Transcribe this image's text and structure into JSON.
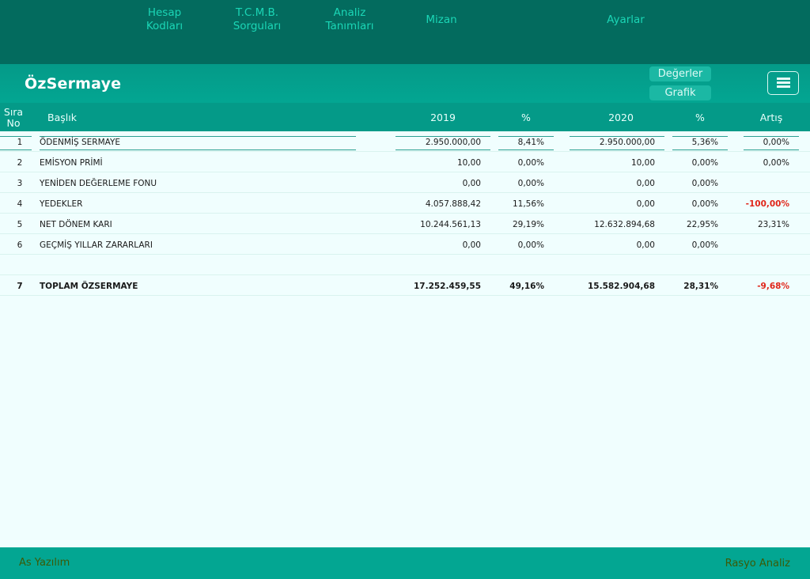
{
  "nav": {
    "hesap": "Hesap\nKodları",
    "tcmb": "T.C.M.B.\nSorguları",
    "analiz": "Analiz\nTanımları",
    "mizan": "Mizan",
    "ayarlar": "Ayarlar"
  },
  "title": "ÖzSermaye",
  "view_buttons": {
    "values": "Değerler",
    "chart": "Grafik"
  },
  "menu_icon": "hamburger-icon",
  "table": {
    "headers": {
      "no": "Sıra\nNo",
      "title": "Başlık",
      "y2019": "2019",
      "pct1": "%",
      "y2020": "2020",
      "pct2": "%",
      "change": "Artış"
    },
    "rows": [
      {
        "no": "1",
        "title": "ÖDENMİŞ SERMAYE",
        "v2019": "2.950.000,00",
        "p2019": "8,41%",
        "v2020": "2.950.000,00",
        "p2020": "5,36%",
        "change": "0,00%"
      },
      {
        "no": "2",
        "title": "EMİSYON PRİMİ",
        "v2019": "10,00",
        "p2019": "0,00%",
        "v2020": "10,00",
        "p2020": "0,00%",
        "change": "0,00%"
      },
      {
        "no": "3",
        "title": "YENİDEN DEĞERLEME FONU",
        "v2019": "0,00",
        "p2019": "0,00%",
        "v2020": "0,00",
        "p2020": "0,00%",
        "change": ""
      },
      {
        "no": "4",
        "title": "YEDEKLER",
        "v2019": "4.057.888,42",
        "p2019": "11,56%",
        "v2020": "0,00",
        "p2020": "0,00%",
        "change": "-100,00%"
      },
      {
        "no": "5",
        "title": "NET DÖNEM KARI",
        "v2019": "10.244.561,13",
        "p2019": "29,19%",
        "v2020": "12.632.894,68",
        "p2020": "22,95%",
        "change": "23,31%"
      },
      {
        "no": "6",
        "title": "GEÇMİŞ YILLAR ZARARLARI",
        "v2019": "0,00",
        "p2019": "0,00%",
        "v2020": "0,00",
        "p2020": "0,00%",
        "change": ""
      }
    ],
    "total": {
      "no": "7",
      "title": "TOPLAM ÖZSERMAYE",
      "v2019": "17.252.459,55",
      "p2019": "49,16%",
      "v2020": "15.582.904,68",
      "p2020": "28,31%",
      "change": "-9,68%"
    }
  },
  "footer": {
    "left": "As Yazılım",
    "right": "Rasyo Analiz"
  }
}
